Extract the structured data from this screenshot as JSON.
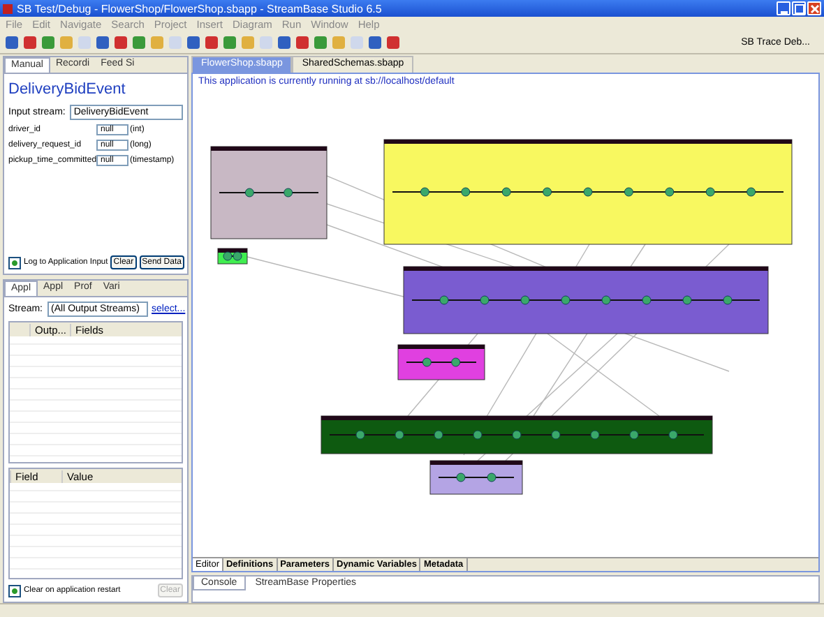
{
  "window": {
    "title": "SB Test/Debug - FlowerShop/FlowerShop.sbapp - StreamBase Studio 6.5"
  },
  "menu": [
    "File",
    "Edit",
    "Navigate",
    "Search",
    "Project",
    "Insert",
    "Diagram",
    "Run",
    "Window",
    "Help"
  ],
  "toolbar": {
    "perspective": "SB Trace Deb..."
  },
  "input_panel": {
    "tabs": [
      {
        "label": "Manual",
        "selected": true
      },
      {
        "label": "Recordi",
        "selected": false
      },
      {
        "label": "Feed Si",
        "selected": false
      }
    ],
    "heading": "DeliveryBidEvent",
    "stream_label": "Input stream:",
    "stream_value": "DeliveryBidEvent",
    "fields": [
      {
        "name": "driver_id",
        "value": "null",
        "type": "(int)"
      },
      {
        "name": "delivery_request_id",
        "value": "null",
        "type": "(long)"
      },
      {
        "name": "pickup_time_committed",
        "value": "null",
        "type": "(timestamp)"
      }
    ],
    "log": {
      "label": "Log to Application Input",
      "checked": true
    },
    "buttons": [
      {
        "label": "Clear",
        "disabled": false
      },
      {
        "label": "Send Data",
        "disabled": false
      }
    ]
  },
  "output_panel": {
    "tabs": [
      {
        "label": "Appl",
        "selected": true
      },
      {
        "label": "Appl",
        "selected": false
      },
      {
        "label": "Prof",
        "selected": false
      },
      {
        "label": "Vari",
        "selected": false
      }
    ],
    "stream_label": "Stream:",
    "stream_value": "(All Output Streams)",
    "link": "select...",
    "columns": [
      "Outp...",
      "Fields"
    ],
    "detail_columns": [
      "Field",
      "Value"
    ],
    "clear_on_restart": {
      "label": "Clear on application restart",
      "checked": true
    },
    "clear_button": {
      "label": "Clear",
      "disabled": true
    }
  },
  "editor": {
    "tabs": [
      {
        "label": "FlowerShop.sbapp",
        "selected": true
      },
      {
        "label": "SharedSchemas.sbapp",
        "selected": false
      }
    ],
    "status_message": "This application is currently running at sb://localhost/default",
    "page_tabs": [
      {
        "label": "Editor",
        "selected": true
      },
      {
        "label": "Definitions",
        "selected": false
      },
      {
        "label": "Parameters",
        "selected": false
      },
      {
        "label": "Dynamic Variables",
        "selected": false
      },
      {
        "label": "Metadata",
        "selected": false
      }
    ]
  },
  "console": {
    "tabs": [
      {
        "label": "Console",
        "selected": true
      },
      {
        "label": "StreamBase Properties",
        "selected": false
      }
    ]
  }
}
